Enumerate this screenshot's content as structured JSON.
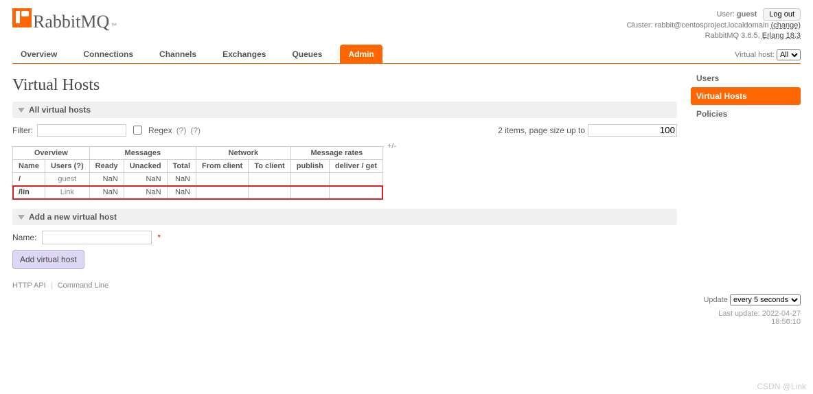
{
  "header": {
    "brand": "RabbitMQ",
    "tm": "™",
    "user_label": "User:",
    "user": "guest",
    "logout": "Log out",
    "cluster_label": "Cluster:",
    "cluster": "rabbit@centosproject.localdomain",
    "change": "(change)",
    "version": "RabbitMQ 3.6.5,",
    "erlang": "Erlang 18.3"
  },
  "tabs": {
    "overview": "Overview",
    "connections": "Connections",
    "channels": "Channels",
    "exchanges": "Exchanges",
    "queues": "Queues",
    "admin": "Admin",
    "vhost_label": "Virtual host:",
    "vhost_selected": "All"
  },
  "page": {
    "title": "Virtual Hosts"
  },
  "sec_all": "All virtual hosts",
  "filter": {
    "label": "Filter:",
    "value": "",
    "regex_label": "Regex",
    "hint1": "(?)",
    "hint2": "(?)",
    "items_text": "2 items, page size up to",
    "page_size": "100"
  },
  "table": {
    "group_overview": "Overview",
    "group_messages": "Messages",
    "group_network": "Network",
    "group_rates": "Message rates",
    "plusminus": "+/-",
    "col_name": "Name",
    "col_users": "Users (?)",
    "col_ready": "Ready",
    "col_unacked": "Unacked",
    "col_total": "Total",
    "col_fromclient": "From client",
    "col_toclient": "To client",
    "col_publish": "publish",
    "col_deliverget": "deliver / get",
    "rows": [
      {
        "name": "/",
        "users": "guest",
        "ready": "NaN",
        "unacked": "NaN",
        "total": "NaN"
      },
      {
        "name": "/lin",
        "users": "Link",
        "ready": "NaN",
        "unacked": "NaN",
        "total": "NaN"
      }
    ]
  },
  "sec_add": "Add a new virtual host",
  "form": {
    "name_label": "Name:",
    "name_value": "",
    "req": "*",
    "submit": "Add virtual host"
  },
  "footer": {
    "api": "HTTP API",
    "cli": "Command Line"
  },
  "side": {
    "users": "Users",
    "vhosts": "Virtual Hosts",
    "policies": "Policies"
  },
  "update": {
    "label": "Update",
    "selected": "every 5 seconds",
    "last_label": "Last update:",
    "last_value": "2022-04-27 18:56:10"
  },
  "watermark": "CSDN @Link"
}
